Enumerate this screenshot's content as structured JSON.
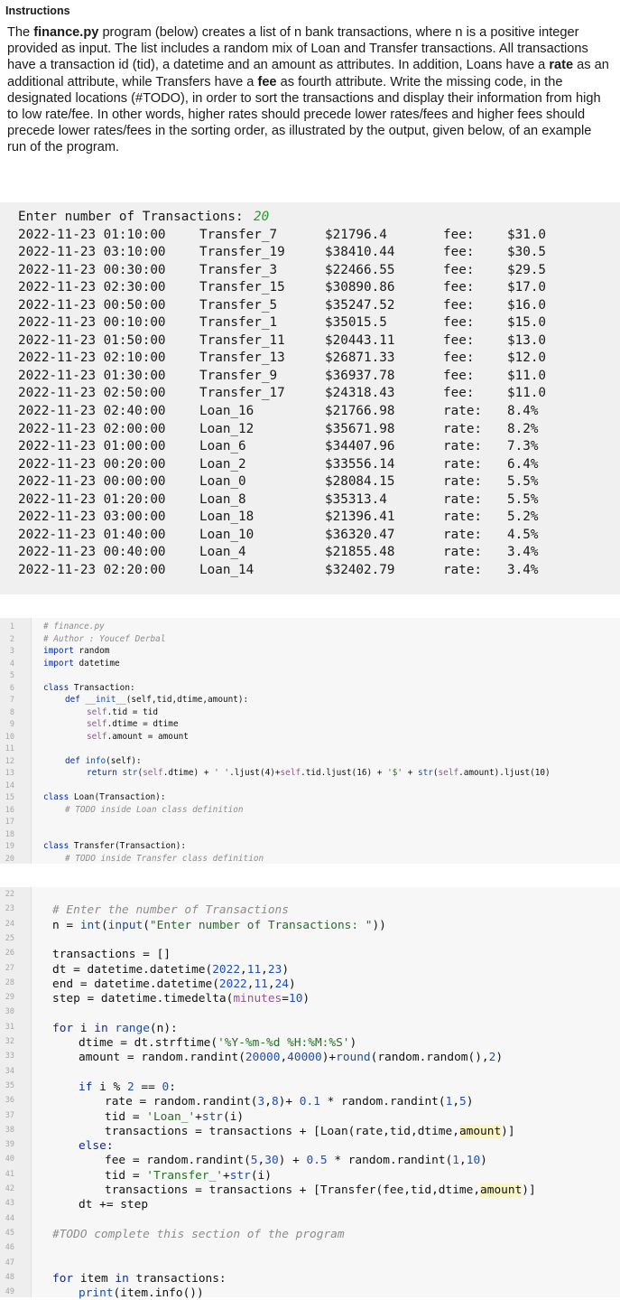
{
  "header": "Instructions",
  "instructions": {
    "p1": "The ",
    "p2": "finance.py",
    "p3": " program (below) creates a list of n bank transactions, where n is a positive integer provided as input. The list includes a random mix of Loan and Transfer transactions. All transactions have a transaction id (tid), a datetime and an amount as attributes. In addition, Loans have a ",
    "p4": "rate",
    "p5": " as an additional attribute, while Transfers have a ",
    "p6": "fee",
    "p7": " as fourth attribute. Write the missing code, in the designated locations (#TODO), in order to sort the transactions and display their information from high to low rate/fee. In other words, higher rates should precede lower rates/fees and higher fees should precede lower rates/fees in the sorting order, as illustrated by the output, given below, of an example run of the program."
  },
  "console": {
    "prompt": "Enter number of Transactions: ",
    "input_value": "20",
    "rows": [
      [
        "2022-11-23 01:10:00",
        "Transfer_7",
        "$21796.4",
        "fee:",
        "$31.0"
      ],
      [
        "2022-11-23 03:10:00",
        "Transfer_19",
        "$38410.44",
        "fee:",
        "$30.5"
      ],
      [
        "2022-11-23 00:30:00",
        "Transfer_3",
        "$22466.55",
        "fee:",
        "$29.5"
      ],
      [
        "2022-11-23 02:30:00",
        "Transfer_15",
        "$30890.86",
        "fee:",
        "$17.0"
      ],
      [
        "2022-11-23 00:50:00",
        "Transfer_5",
        "$35247.52",
        "fee:",
        "$16.0"
      ],
      [
        "2022-11-23 00:10:00",
        "Transfer_1",
        "$35015.5",
        "fee:",
        "$15.0"
      ],
      [
        "2022-11-23 01:50:00",
        "Transfer_11",
        "$20443.11",
        "fee:",
        "$13.0"
      ],
      [
        "2022-11-23 02:10:00",
        "Transfer_13",
        "$26871.33",
        "fee:",
        "$12.0"
      ],
      [
        "2022-11-23 01:30:00",
        "Transfer_9",
        "$36937.78",
        "fee:",
        "$11.0"
      ],
      [
        "2022-11-23 02:50:00",
        "Transfer_17",
        "$24318.43",
        "fee:",
        "$11.0"
      ],
      [
        "2022-11-23 02:40:00",
        "Loan_16",
        "$21766.98",
        "rate:",
        "8.4%"
      ],
      [
        "2022-11-23 02:00:00",
        "Loan_12",
        "$35671.98",
        "rate:",
        "8.2%"
      ],
      [
        "2022-11-23 01:00:00",
        "Loan_6",
        "$34407.96",
        "rate:",
        "7.3%"
      ],
      [
        "2022-11-23 00:20:00",
        "Loan_2",
        "$33556.14",
        "rate:",
        "6.4%"
      ],
      [
        "2022-11-23 00:00:00",
        "Loan_0",
        "$28084.15",
        "rate:",
        "5.5%"
      ],
      [
        "2022-11-23 01:20:00",
        "Loan_8",
        "$35313.4",
        "rate:",
        "5.5%"
      ],
      [
        "2022-11-23 03:00:00",
        "Loan_18",
        "$21396.41",
        "rate:",
        "5.2%"
      ],
      [
        "2022-11-23 01:40:00",
        "Loan_10",
        "$36320.47",
        "rate:",
        "4.5%"
      ],
      [
        "2022-11-23 00:40:00",
        "Loan_4",
        "$21855.48",
        "rate:",
        "3.4%"
      ],
      [
        "2022-11-23 02:20:00",
        "Loan_14",
        "$32402.79",
        "rate:",
        "3.4%"
      ]
    ]
  },
  "code1_line_numbers": [
    "1",
    "2",
    "3",
    "4",
    "5",
    "6",
    "7",
    "8",
    "9",
    "10",
    "11",
    "12",
    "13",
    "14",
    "15",
    "16",
    "17",
    "18",
    "19",
    "20"
  ],
  "code1": [
    {
      "n": 0,
      "t": [
        [
          "c",
          "# finance.py"
        ]
      ]
    },
    {
      "n": 1,
      "t": [
        [
          "c",
          "# Author : Youcef Derbal"
        ]
      ]
    },
    {
      "n": 2,
      "t": [
        [
          "k",
          "import"
        ],
        [
          "",
          "random"
        ]
      ]
    },
    {
      "n": 3,
      "t": [
        [
          "k",
          "import"
        ],
        [
          "",
          "datetime"
        ]
      ]
    },
    {
      "n": 5,
      "t": [
        [
          "k",
          "class"
        ],
        [
          "",
          "Transaction:"
        ]
      ]
    },
    {
      "n": 6,
      "i": 1,
      "t": [
        [
          "k",
          "def"
        ],
        [
          "f",
          "__init__"
        ],
        [
          "",
          "(self,tid,dtime,amount):"
        ]
      ]
    },
    {
      "n": 7,
      "i": 2,
      "t": [
        [
          "sf",
          "self"
        ],
        [
          "",
          ".tid = tid"
        ]
      ]
    },
    {
      "n": 8,
      "i": 2,
      "t": [
        [
          "sf",
          "self"
        ],
        [
          "",
          ".dtime = dtime"
        ]
      ]
    },
    {
      "n": 9,
      "i": 2,
      "t": [
        [
          "sf",
          "self"
        ],
        [
          "",
          ".amount = amount"
        ]
      ]
    },
    {
      "n": 11,
      "i": 1,
      "t": [
        [
          "k",
          "def"
        ],
        [
          "f",
          "info"
        ],
        [
          "",
          "(self):"
        ]
      ]
    },
    {
      "n": 12,
      "i": 2,
      "t": [
        [
          "k",
          "return"
        ],
        [
          "f",
          "str"
        ],
        [
          "",
          "("
        ],
        [
          "sf",
          "self"
        ],
        [
          "",
          ".dtime) + "
        ],
        [
          "s",
          "' '"
        ],
        [
          "",
          ".ljust(4)+"
        ],
        [
          "sf",
          "self"
        ],
        [
          "",
          ".tid.ljust(16) + "
        ],
        [
          "s",
          "'$'"
        ],
        [
          "",
          " + "
        ],
        [
          "f",
          "str"
        ],
        [
          "",
          "("
        ],
        [
          "sf",
          "self"
        ],
        [
          "",
          ".amount).ljust(10)"
        ]
      ]
    },
    {
      "n": 14,
      "t": [
        [
          "k",
          "class"
        ],
        [
          "",
          "Loan(Transaction):"
        ]
      ]
    },
    {
      "n": 15,
      "i": 1,
      "t": [
        [
          "c",
          "# TODO inside Loan class definition"
        ]
      ]
    },
    {
      "n": 18,
      "t": [
        [
          "k",
          "class"
        ],
        [
          "",
          "Transfer(Transaction):"
        ]
      ]
    },
    {
      "n": 19,
      "i": 1,
      "t": [
        [
          "c",
          "# TODO inside Transfer class definition"
        ]
      ]
    }
  ],
  "code2_line_numbers": [
    "22",
    "23",
    "24",
    "25",
    "26",
    "27",
    "28",
    "29",
    "30",
    "31",
    "32",
    "33",
    "34",
    "35",
    "36",
    "37",
    "38",
    "39",
    "40",
    "41",
    "42",
    "43",
    "44",
    "45",
    "46",
    "47",
    "48",
    "49"
  ],
  "code2": [
    {
      "n": 1,
      "t": [
        [
          "c",
          "# Enter the number of Transactions"
        ]
      ]
    },
    {
      "n": 2,
      "t": [
        [
          "",
          "n = "
        ],
        [
          "f",
          "int"
        ],
        [
          "",
          "("
        ],
        [
          "f",
          "input"
        ],
        [
          "",
          "("
        ],
        [
          "s",
          "\"Enter number of Transactions: \""
        ],
        [
          "",
          "))"
        ]
      ]
    },
    {
      "n": 4,
      "t": [
        [
          "",
          "transactions = []"
        ]
      ]
    },
    {
      "n": 5,
      "t": [
        [
          "",
          "dt = datetime.datetime("
        ],
        [
          "n",
          "2022"
        ],
        [
          "",
          ","
        ],
        [
          "n",
          "11"
        ],
        [
          "",
          ","
        ],
        [
          "n",
          "23"
        ],
        [
          "",
          ")"
        ]
      ]
    },
    {
      "n": 6,
      "t": [
        [
          "",
          "end = datetime.datetime("
        ],
        [
          "n",
          "2022"
        ],
        [
          "",
          ","
        ],
        [
          "n",
          "11"
        ],
        [
          "",
          ","
        ],
        [
          "n",
          "24"
        ],
        [
          "",
          ")"
        ]
      ]
    },
    {
      "n": 7,
      "t": [
        [
          "",
          "step = datetime.timedelta("
        ],
        [
          "sf",
          "minutes"
        ],
        [
          "",
          "="
        ],
        [
          "n",
          "10"
        ],
        [
          "",
          ")"
        ]
      ]
    },
    {
      "n": 9,
      "t": [
        [
          "k",
          "for"
        ],
        [
          "",
          "i "
        ],
        [
          "k",
          "in"
        ],
        [
          "f",
          "range"
        ],
        [
          "",
          "(n):"
        ]
      ]
    },
    {
      "n": 10,
      "i": 1,
      "t": [
        [
          "",
          "dtime = dt.strftime("
        ],
        [
          "s",
          "'%Y-%m-%d %H:%M:%S'"
        ],
        [
          "",
          ")"
        ]
      ]
    },
    {
      "n": 11,
      "i": 1,
      "t": [
        [
          "",
          "amount = random.randint("
        ],
        [
          "n",
          "20000"
        ],
        [
          "",
          ","
        ],
        [
          "n",
          "40000"
        ],
        [
          "",
          ")+"
        ],
        [
          "f",
          "round"
        ],
        [
          "",
          "(random.random(),"
        ],
        [
          "n",
          "2"
        ],
        [
          "",
          ")"
        ]
      ]
    },
    {
      "n": 13,
      "i": 1,
      "t": [
        [
          "k",
          "if"
        ],
        [
          "",
          "i % "
        ],
        [
          "n",
          "2"
        ],
        [
          "",
          " == "
        ],
        [
          "n",
          "0"
        ],
        [
          "",
          ":"
        ]
      ]
    },
    {
      "n": 14,
      "i": 2,
      "t": [
        [
          "",
          "rate = random.randint("
        ],
        [
          "n",
          "3"
        ],
        [
          "",
          ","
        ],
        [
          "n",
          "8"
        ],
        [
          "",
          ")+ "
        ],
        [
          "n",
          "0.1"
        ],
        [
          "",
          " * random.randint("
        ],
        [
          "n",
          "1"
        ],
        [
          "",
          ","
        ],
        [
          "n",
          "5"
        ],
        [
          "",
          ")"
        ]
      ]
    },
    {
      "n": 15,
      "i": 2,
      "t": [
        [
          "",
          "tid = "
        ],
        [
          "s",
          "'Loan_'"
        ],
        [
          "",
          "+"
        ],
        [
          "f",
          "str"
        ],
        [
          "",
          "(i)"
        ]
      ]
    },
    {
      "n": 16,
      "i": 2,
      "t": [
        [
          "",
          "transactions = transactions + [Loan(rate,tid,dtime,"
        ],
        [
          "hl",
          "amount"
        ],
        [
          "",
          ")]"
        ]
      ]
    },
    {
      "n": 17,
      "i": 1,
      "t": [
        [
          "k",
          "else"
        ],
        [
          "",
          ":"
        ]
      ]
    },
    {
      "n": 18,
      "i": 2,
      "t": [
        [
          "",
          "fee = random.randint("
        ],
        [
          "n",
          "5"
        ],
        [
          "",
          ","
        ],
        [
          "n",
          "30"
        ],
        [
          "",
          ") + "
        ],
        [
          "n",
          "0.5"
        ],
        [
          "",
          " * random.randint("
        ],
        [
          "n",
          "1"
        ],
        [
          "",
          ","
        ],
        [
          "n",
          "10"
        ],
        [
          "",
          ")"
        ]
      ]
    },
    {
      "n": 19,
      "i": 2,
      "t": [
        [
          "",
          "tid = "
        ],
        [
          "s",
          "'Transfer_'"
        ],
        [
          "",
          "+"
        ],
        [
          "f",
          "str"
        ],
        [
          "",
          "(i)"
        ]
      ]
    },
    {
      "n": 20,
      "i": 2,
      "t": [
        [
          "",
          "transactions = transactions + [Transfer(fee,tid,dtime,"
        ],
        [
          "hl",
          "amount"
        ],
        [
          "",
          ")]"
        ]
      ]
    },
    {
      "n": 21,
      "i": 1,
      "t": [
        [
          "",
          "dt += step"
        ]
      ]
    },
    {
      "n": 23,
      "t": [
        [
          "c",
          "#TODO complete this section of the program"
        ]
      ]
    },
    {
      "n": 26,
      "t": [
        [
          "k",
          "for"
        ],
        [
          "",
          "item "
        ],
        [
          "k",
          "in"
        ],
        [
          "",
          "transactions:"
        ]
      ]
    },
    {
      "n": 27,
      "i": 1,
      "t": [
        [
          "f",
          "print"
        ],
        [
          "",
          "(item.info())"
        ]
      ]
    }
  ],
  "colors": {
    "console_bg": "#f0f0f0",
    "code_bg": "#f7f7f7",
    "keyword": "#0a2a9a",
    "string": "#237023",
    "comment": "#8c8c8c",
    "input": "#2a9a2a"
  }
}
